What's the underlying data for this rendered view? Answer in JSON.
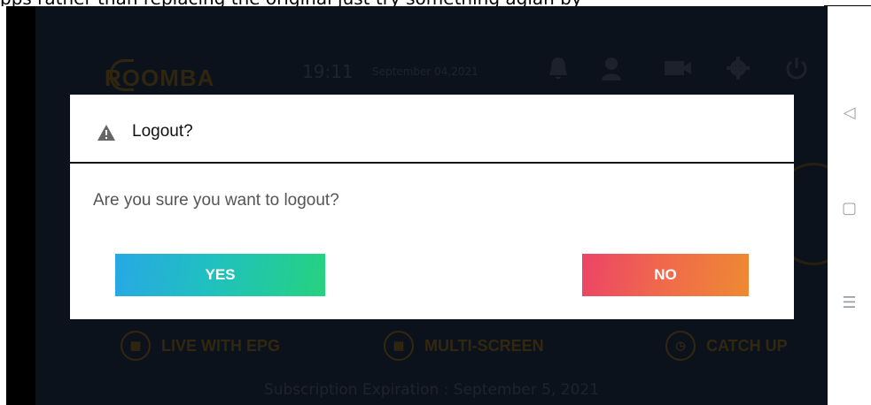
{
  "caption": "pps rather than replacing the original just try something agian by",
  "app": {
    "logo": "ROOMBA",
    "time": "19:11",
    "date": "September 04,2021",
    "icons": [
      "bell-icon",
      "user-icon",
      "video-camera-icon",
      "settings-icon",
      "power-icon"
    ],
    "menu": [
      {
        "label": "LIVE WITH EPG",
        "icon": "calendar-icon"
      },
      {
        "label": "MULTI-SCREEN",
        "icon": "grid-icon"
      },
      {
        "label": "CATCH UP",
        "icon": "clock-icon"
      }
    ],
    "subscription": "Subscription Expiration : September 5, 2021"
  },
  "dialog": {
    "title": "Logout?",
    "message": "Are you sure you want to logout?",
    "yes_label": "YES",
    "no_label": "NO"
  },
  "nav": {
    "back": "◁",
    "home": "▢",
    "menu": "☰"
  },
  "colors": {
    "yes_gradient_start": "#27a8e4",
    "yes_gradient_end": "#26d27f",
    "no_gradient_start": "#ec4466",
    "no_gradient_end": "#ee8a32",
    "app_background": "#131c2b"
  }
}
